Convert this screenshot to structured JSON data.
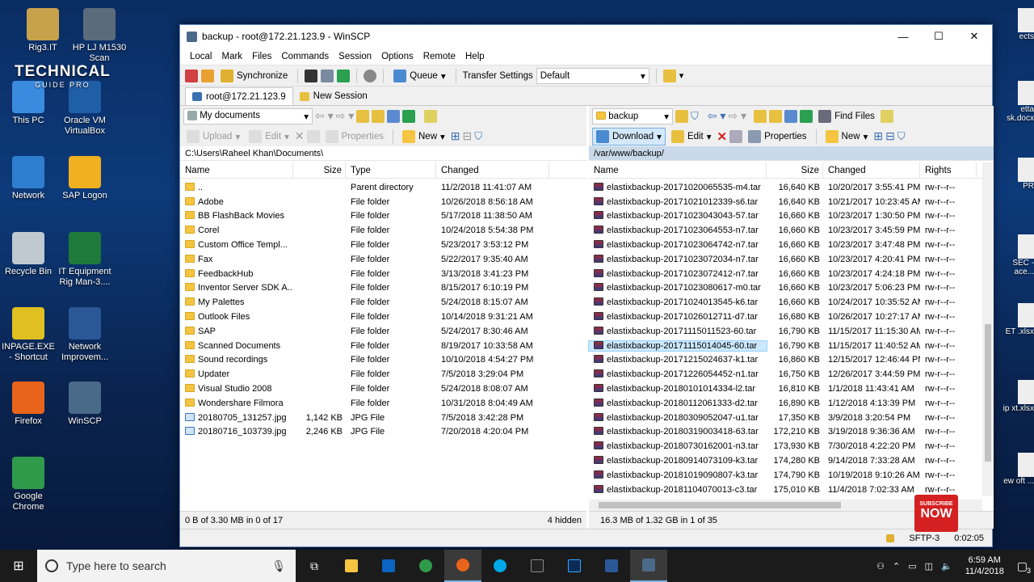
{
  "desktop": {
    "icons": [
      {
        "label": "Rig3.IT",
        "color": "#c8a24a"
      },
      {
        "label": "HP LJ M1530 Scan",
        "color": "#5b6b7b"
      },
      {
        "label": "This PC",
        "color": "#3a8be0"
      },
      {
        "label": "Oracle VM VirtualBox",
        "color": "#1f5fa8"
      },
      {
        "label": "Network",
        "color": "#2f7fd0"
      },
      {
        "label": "SAP Logon",
        "color": "#f0b020"
      },
      {
        "label": "Recycle Bin",
        "color": "#c0c8d0"
      },
      {
        "label": "IT Equipment Rig Man-3....",
        "color": "#1e7a3a"
      },
      {
        "label": "INPAGE.EXE - Shortcut",
        "color": "#e0c020"
      },
      {
        "label": "Network Improvem...",
        "color": "#2b5797"
      },
      {
        "label": "Firefox",
        "color": "#e8641b"
      },
      {
        "label": "WinSCP",
        "color": "#4a6a8a"
      },
      {
        "label": "Google Chrome",
        "color": "#2f9b4a"
      }
    ],
    "watermark_top": "TECHNICAL",
    "watermark_sub": "GUIDE PRO",
    "right_fragments": [
      "ects",
      "etta  sk.docx",
      "PR",
      "SEC -  ace...",
      "ET  .xlsx",
      "ip  xt.xlsx",
      "ew  oft ..."
    ]
  },
  "window": {
    "title": "backup - root@172.21.123.9 - WinSCP",
    "controls": {
      "minimize": "—",
      "maximize": "☐",
      "close": "✕"
    },
    "menu": [
      "Local",
      "Mark",
      "Files",
      "Commands",
      "Session",
      "Options",
      "Remote",
      "Help"
    ],
    "toolbar": {
      "synchronize": "Synchronize",
      "queue": "Queue",
      "transfer_settings_label": "Transfer Settings",
      "transfer_settings_value": "Default"
    },
    "tabs": {
      "session": "root@172.21.123.9",
      "new_session": "New Session"
    }
  },
  "left": {
    "location": "My documents",
    "actions": {
      "upload": "Upload",
      "edit": "Edit",
      "properties": "Properties",
      "new": "New"
    },
    "path": "C:\\Users\\Raheel Khan\\Documents\\",
    "columns": [
      "Name",
      "Size",
      "Type",
      "Changed"
    ],
    "rows": [
      {
        "name": "..",
        "size": "",
        "type": "Parent directory",
        "changed": "11/2/2018  11:41:07 AM",
        "icon": "up"
      },
      {
        "name": "Adobe",
        "size": "",
        "type": "File folder",
        "changed": "10/26/2018  8:56:18 AM",
        "icon": "folder"
      },
      {
        "name": "BB FlashBack Movies",
        "size": "",
        "type": "File folder",
        "changed": "5/17/2018  11:38:50 AM",
        "icon": "folder"
      },
      {
        "name": "Corel",
        "size": "",
        "type": "File folder",
        "changed": "10/24/2018  5:54:38 PM",
        "icon": "folder"
      },
      {
        "name": "Custom Office Templ...",
        "size": "",
        "type": "File folder",
        "changed": "5/23/2017  3:53:12 PM",
        "icon": "folder"
      },
      {
        "name": "Fax",
        "size": "",
        "type": "File folder",
        "changed": "5/22/2017  9:35:40 AM",
        "icon": "folder"
      },
      {
        "name": "FeedbackHub",
        "size": "",
        "type": "File folder",
        "changed": "3/13/2018  3:41:23 PM",
        "icon": "folder"
      },
      {
        "name": "Inventor Server SDK A...",
        "size": "",
        "type": "File folder",
        "changed": "8/15/2017  6:10:19 PM",
        "icon": "folder"
      },
      {
        "name": "My Palettes",
        "size": "",
        "type": "File folder",
        "changed": "5/24/2018  8:15:07 AM",
        "icon": "folder"
      },
      {
        "name": "Outlook Files",
        "size": "",
        "type": "File folder",
        "changed": "10/14/2018  9:31:21 AM",
        "icon": "folder"
      },
      {
        "name": "SAP",
        "size": "",
        "type": "File folder",
        "changed": "5/24/2017  8:30:46 AM",
        "icon": "folder"
      },
      {
        "name": "Scanned Documents",
        "size": "",
        "type": "File folder",
        "changed": "8/19/2017  10:33:58 AM",
        "icon": "folder"
      },
      {
        "name": "Sound recordings",
        "size": "",
        "type": "File folder",
        "changed": "10/10/2018  4:54:27 PM",
        "icon": "folder"
      },
      {
        "name": "Updater",
        "size": "",
        "type": "File folder",
        "changed": "7/5/2018  3:29:04 PM",
        "icon": "folder"
      },
      {
        "name": "Visual Studio 2008",
        "size": "",
        "type": "File folder",
        "changed": "5/24/2018  8:08:07 AM",
        "icon": "folder"
      },
      {
        "name": "Wondershare Filmora",
        "size": "",
        "type": "File folder",
        "changed": "10/31/2018  8:04:49 AM",
        "icon": "folder"
      },
      {
        "name": "20180705_131257.jpg",
        "size": "1,142 KB",
        "type": "JPG File",
        "changed": "7/5/2018  3:42:28 PM",
        "icon": "jpg"
      },
      {
        "name": "20180716_103739.jpg",
        "size": "2,246 KB",
        "type": "JPG File",
        "changed": "7/20/2018  4:20:04 PM",
        "icon": "jpg"
      }
    ],
    "status_left": "0 B of 3.30 MB in 0 of 17",
    "status_right": "4 hidden"
  },
  "right": {
    "location": "backup",
    "find_files": "Find Files",
    "actions": {
      "download": "Download",
      "edit": "Edit",
      "properties": "Properties",
      "new": "New"
    },
    "path": "/var/www/backup/",
    "columns": [
      "Name",
      "Size",
      "Changed",
      "Rights"
    ],
    "selected_index": 11,
    "rows": [
      {
        "name": "elastixbackup-20171020065535-m4.tar",
        "size": "16,640 KB",
        "changed": "10/20/2017 3:55:41 PM",
        "rights": "rw-r--r--"
      },
      {
        "name": "elastixbackup-20171021012339-s6.tar",
        "size": "16,640 KB",
        "changed": "10/21/2017 10:23:45 AM",
        "rights": "rw-r--r--"
      },
      {
        "name": "elastixbackup-20171023043043-57.tar",
        "size": "16,660 KB",
        "changed": "10/23/2017 1:30:50 PM",
        "rights": "rw-r--r--"
      },
      {
        "name": "elastixbackup-20171023064553-n7.tar",
        "size": "16,660 KB",
        "changed": "10/23/2017 3:45:59 PM",
        "rights": "rw-r--r--"
      },
      {
        "name": "elastixbackup-20171023064742-n7.tar",
        "size": "16,660 KB",
        "changed": "10/23/2017 3:47:48 PM",
        "rights": "rw-r--r--"
      },
      {
        "name": "elastixbackup-20171023072034-n7.tar",
        "size": "16,660 KB",
        "changed": "10/23/2017 4:20:41 PM",
        "rights": "rw-r--r--"
      },
      {
        "name": "elastixbackup-20171023072412-n7.tar",
        "size": "16,660 KB",
        "changed": "10/23/2017 4:24:18 PM",
        "rights": "rw-r--r--"
      },
      {
        "name": "elastixbackup-20171023080617-m0.tar",
        "size": "16,660 KB",
        "changed": "10/23/2017 5:06:23 PM",
        "rights": "rw-r--r--"
      },
      {
        "name": "elastixbackup-20171024013545-k6.tar",
        "size": "16,660 KB",
        "changed": "10/24/2017 10:35:52 AM",
        "rights": "rw-r--r--"
      },
      {
        "name": "elastixbackup-20171026012711-d7.tar",
        "size": "16,680 KB",
        "changed": "10/26/2017 10:27:17 AM",
        "rights": "rw-r--r--"
      },
      {
        "name": "elastixbackup-20171115011523-60.tar",
        "size": "16,790 KB",
        "changed": "11/15/2017 11:15:30 AM",
        "rights": "rw-r--r--"
      },
      {
        "name": "elastixbackup-20171115014045-60.tar",
        "size": "16,790 KB",
        "changed": "11/15/2017 11:40:52 AM",
        "rights": "rw-r--r--"
      },
      {
        "name": "elastixbackup-20171215024637-k1.tar",
        "size": "16,860 KB",
        "changed": "12/15/2017 12:46:44 PM",
        "rights": "rw-r--r--"
      },
      {
        "name": "elastixbackup-20171226054452-n1.tar",
        "size": "16,750 KB",
        "changed": "12/26/2017 3:44:59 PM",
        "rights": "rw-r--r--"
      },
      {
        "name": "elastixbackup-20180101014334-l2.tar",
        "size": "16,810 KB",
        "changed": "1/1/2018 11:43:41 AM",
        "rights": "rw-r--r--"
      },
      {
        "name": "elastixbackup-20180112061333-d2.tar",
        "size": "16,890 KB",
        "changed": "1/12/2018 4:13:39 PM",
        "rights": "rw-r--r--"
      },
      {
        "name": "elastixbackup-20180309052047-u1.tar",
        "size": "17,350 KB",
        "changed": "3/9/2018 3:20:54 PM",
        "rights": "rw-r--r--"
      },
      {
        "name": "elastixbackup-20180319003418-63.tar",
        "size": "172,210 KB",
        "changed": "3/19/2018 9:36:36 AM",
        "rights": "rw-r--r--"
      },
      {
        "name": "elastixbackup-20180730162001-n3.tar",
        "size": "173,930 KB",
        "changed": "7/30/2018 4:22:20 PM",
        "rights": "rw-r--r--"
      },
      {
        "name": "elastixbackup-20180914073109-k3.tar",
        "size": "174,280 KB",
        "changed": "9/14/2018 7:33:28 AM",
        "rights": "rw-r--r--"
      },
      {
        "name": "elastixbackup-20181019090807-k3.tar",
        "size": "174,790 KB",
        "changed": "10/19/2018 9:10:26 AM",
        "rights": "rw-r--r--"
      },
      {
        "name": "elastixbackup-20181104070013-c3.tar",
        "size": "175,010 KB",
        "changed": "11/4/2018 7:02:33 AM",
        "rights": "rw-r--r--"
      }
    ],
    "status_left": "16.3 MB of 1.32 GB in 1 of 35",
    "protocol": "SFTP-3",
    "elapsed": "0:02:05"
  },
  "subscribe": {
    "line1": "SUBSCRIBE",
    "line2": "NOW"
  },
  "taskbar": {
    "search_placeholder": "Type here to search",
    "time": "6:59 AM",
    "date": "11/4/2018",
    "notifications": "3"
  }
}
